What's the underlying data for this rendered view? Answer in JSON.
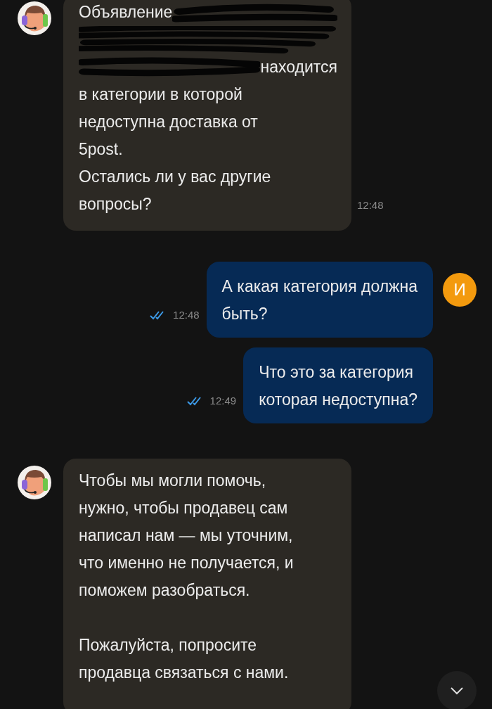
{
  "messages": [
    {
      "kind": "incoming",
      "time": "12:48",
      "lines": [
        {
          "kind": "partial_start",
          "text": "Объявление"
        },
        {
          "kind": "redacted"
        },
        {
          "kind": "partial_end",
          "text": "находится"
        },
        {
          "kind": "text",
          "text": "в категории в которой"
        },
        {
          "kind": "text",
          "text": "недоступна доставка от"
        },
        {
          "kind": "text",
          "text": "5post."
        },
        {
          "kind": "text",
          "text": "Остались ли у вас другие"
        },
        {
          "kind": "text",
          "text": "вопросы?"
        }
      ]
    },
    {
      "kind": "outgoing",
      "time": "12:48",
      "read": true,
      "avatar": "И",
      "lines": [
        {
          "kind": "text",
          "text": "А какая категория должна"
        },
        {
          "kind": "text",
          "text": "быть?"
        }
      ]
    },
    {
      "kind": "outgoing",
      "time": "12:49",
      "read": true,
      "lines": [
        {
          "kind": "text",
          "text": "Что это за категория"
        },
        {
          "kind": "text",
          "text": "которая недоступна?"
        }
      ]
    },
    {
      "kind": "incoming",
      "lines": [
        {
          "kind": "text",
          "text": "Чтобы мы могли помочь,"
        },
        {
          "kind": "text",
          "text": "нужно, чтобы продавец сам"
        },
        {
          "kind": "text",
          "text": "написал нам — мы уточним,"
        },
        {
          "kind": "text",
          "text": "что именно не получается, и"
        },
        {
          "kind": "text",
          "text": "поможем разобраться."
        },
        {
          "kind": "gap"
        },
        {
          "kind": "text",
          "text": "Пожалуйста, попросите"
        },
        {
          "kind": "text",
          "text": "продавца связаться с нами."
        }
      ]
    }
  ],
  "scroll_down_button": true
}
